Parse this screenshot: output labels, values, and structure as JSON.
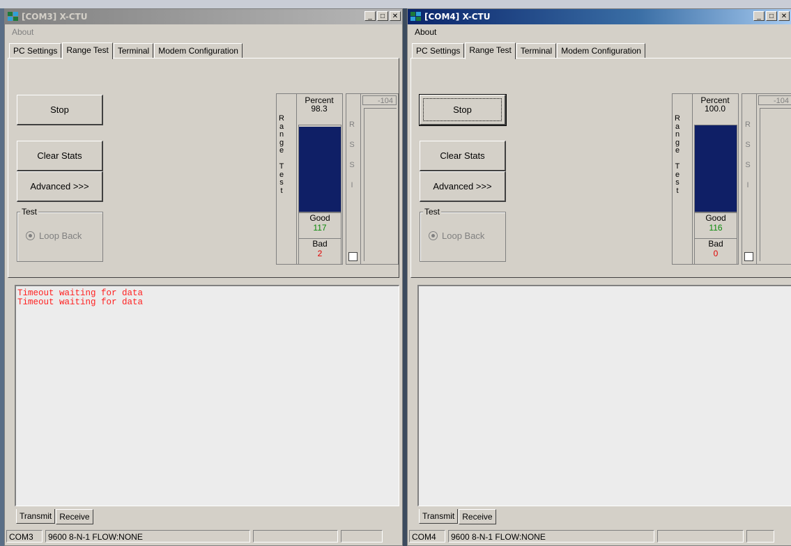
{
  "windows": [
    {
      "id": "com3",
      "title": "[COM3] X-CTU",
      "active": false,
      "menu": [
        "About"
      ],
      "tabs": [
        "PC Settings",
        "Range Test",
        "Terminal",
        "Modem Configuration"
      ],
      "selected_tab": "Range Test",
      "buttons": {
        "stop": "Stop",
        "clear_stats": "Clear Stats",
        "advanced": "Advanced >>>"
      },
      "test_group": {
        "label": "Test",
        "option": "Loop Back"
      },
      "range_test": {
        "side_label": "Range Test",
        "percent_label": "Percent",
        "percent": "98.3",
        "percent_value": 98.3,
        "good_label": "Good",
        "good": "117",
        "bad_label": "Bad",
        "bad": "2"
      },
      "rssi": {
        "label": "RSSI",
        "value": "-104"
      },
      "terminal_lines": [
        "Timeout waiting for data",
        "Timeout waiting for data"
      ],
      "bottom_tabs": [
        "Transmit",
        "Receive"
      ],
      "status": {
        "port": "COM3",
        "settings": "9600 8-N-1  FLOW:NONE",
        "p3": "",
        "p4": ""
      }
    },
    {
      "id": "com4",
      "title": "[COM4] X-CTU",
      "active": true,
      "menu": [
        "About"
      ],
      "tabs": [
        "PC Settings",
        "Range Test",
        "Terminal",
        "Modem Configuration"
      ],
      "selected_tab": "Range Test",
      "buttons": {
        "stop": "Stop",
        "clear_stats": "Clear Stats",
        "advanced": "Advanced >>>"
      },
      "test_group": {
        "label": "Test",
        "option": "Loop Back"
      },
      "range_test": {
        "side_label": "Range Test",
        "percent_label": "Percent",
        "percent": "100.0",
        "percent_value": 100.0,
        "good_label": "Good",
        "good": "116",
        "bad_label": "Bad",
        "bad": "0"
      },
      "rssi": {
        "label": "RSSI",
        "value": "-104"
      },
      "terminal_lines": [],
      "bottom_tabs": [
        "Transmit",
        "Receive"
      ],
      "status": {
        "port": "COM4",
        "settings": "9600 8-N-1  FLOW:NONE",
        "p3": "",
        "p4": ""
      }
    }
  ],
  "colors": {
    "bar_fill": "#0f1f66",
    "good_value": "#0a8a0a",
    "bad_value": "#e00000",
    "terminal_text": "#ff2020"
  }
}
